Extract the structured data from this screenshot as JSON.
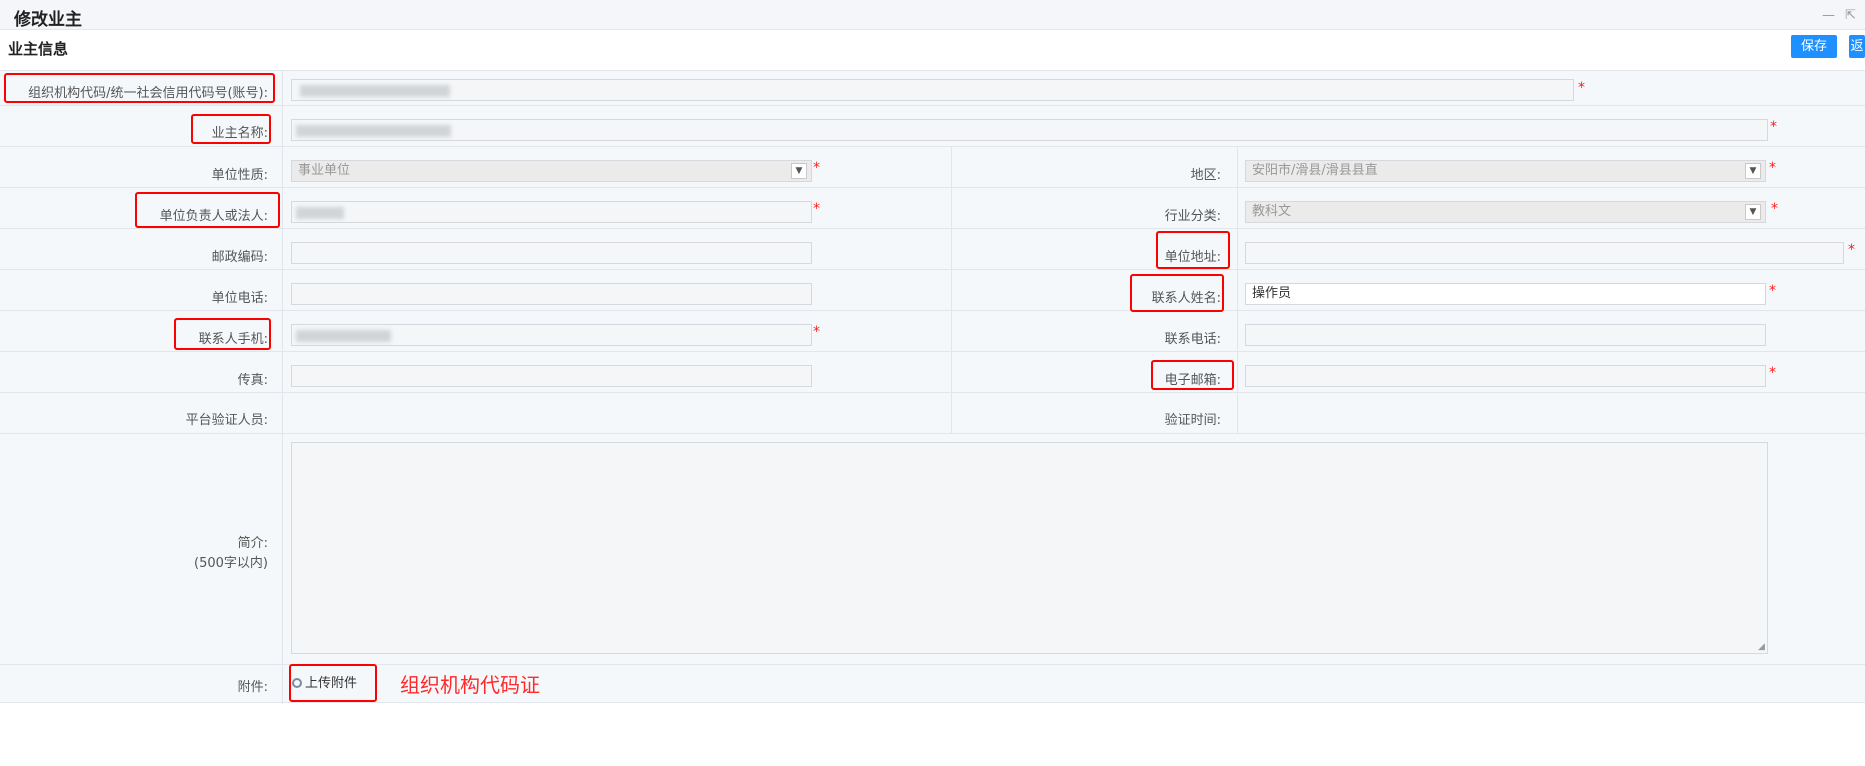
{
  "window": {
    "title": "修改业主",
    "minimize_icon": "minimize-icon",
    "popout_icon": "popout-icon"
  },
  "section": {
    "title": "业主信息"
  },
  "buttons": {
    "save": "保存",
    "back": "返"
  },
  "form": {
    "org_code": {
      "label": "组织机构代码/统一社会信用代码号(账号):",
      "value": "",
      "required": "*"
    },
    "owner_name": {
      "label": "业主名称:",
      "value": "",
      "required": "*"
    },
    "unit_nature": {
      "label": "单位性质:",
      "value": "事业单位",
      "required": "*"
    },
    "region": {
      "label": "地区:",
      "value": "安阳市/滑县/滑县县直",
      "required": "*"
    },
    "legal_person": {
      "label": "单位负责人或法人:",
      "value": "",
      "required": "*"
    },
    "industry": {
      "label": "行业分类:",
      "value": "教科文",
      "required": "*"
    },
    "postcode": {
      "label": "邮政编码:",
      "value": ""
    },
    "address": {
      "label": "单位地址:",
      "value": "",
      "required": "*"
    },
    "unit_phone": {
      "label": "单位电话:",
      "value": ""
    },
    "contact_name": {
      "label": "联系人姓名:",
      "value": "操作员",
      "required": "*"
    },
    "contact_mobile": {
      "label": "联系人手机:",
      "value": "",
      "required": "*"
    },
    "contact_phone": {
      "label": "联系电话:",
      "value": ""
    },
    "fax": {
      "label": "传真:",
      "value": ""
    },
    "email": {
      "label": "电子邮箱:",
      "value": "",
      "required": "*"
    },
    "verifier": {
      "label": "平台验证人员:",
      "value": ""
    },
    "verify_time": {
      "label": "验证时间:",
      "value": ""
    },
    "intro": {
      "label": "简介:",
      "hint": "(500字以内)",
      "value": ""
    },
    "attachment": {
      "label": "附件:",
      "upload_label": "上传附件",
      "note": "组织机构代码证"
    }
  }
}
